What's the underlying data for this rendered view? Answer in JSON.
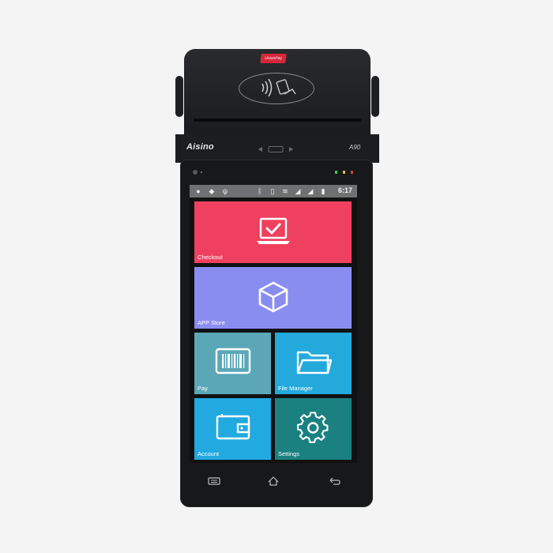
{
  "device": {
    "brand": "Aisino",
    "model": "A90",
    "nfc_badge": "UnionPay"
  },
  "statusbar": {
    "left_icons": [
      "android-icon",
      "location-icon",
      "usb-icon"
    ],
    "right_icons": [
      "bluetooth-icon",
      "vibrate-icon",
      "wifi-icon",
      "signal-icon",
      "signal-icon",
      "battery-icon"
    ],
    "time": "6:17"
  },
  "tiles": {
    "checkout": {
      "label": "Checkout",
      "icon": "laptop-check-icon",
      "color": "#f0405f"
    },
    "app_store": {
      "label": "APP Store",
      "icon": "box-icon",
      "color": "#8a8df0"
    },
    "pay": {
      "label": "Pay",
      "icon": "barcode-icon",
      "color": "#5ba7b7"
    },
    "file_manager": {
      "label": "File Manager",
      "icon": "folder-icon",
      "color": "#24a9dc"
    },
    "account": {
      "label": "Account",
      "icon": "wallet-icon",
      "color": "#22a9e0"
    },
    "settings": {
      "label": "Settings",
      "icon": "gear-icon",
      "color": "#1a8080"
    }
  },
  "navbar": {
    "buttons": [
      "menu-icon",
      "home-icon",
      "back-icon"
    ]
  }
}
